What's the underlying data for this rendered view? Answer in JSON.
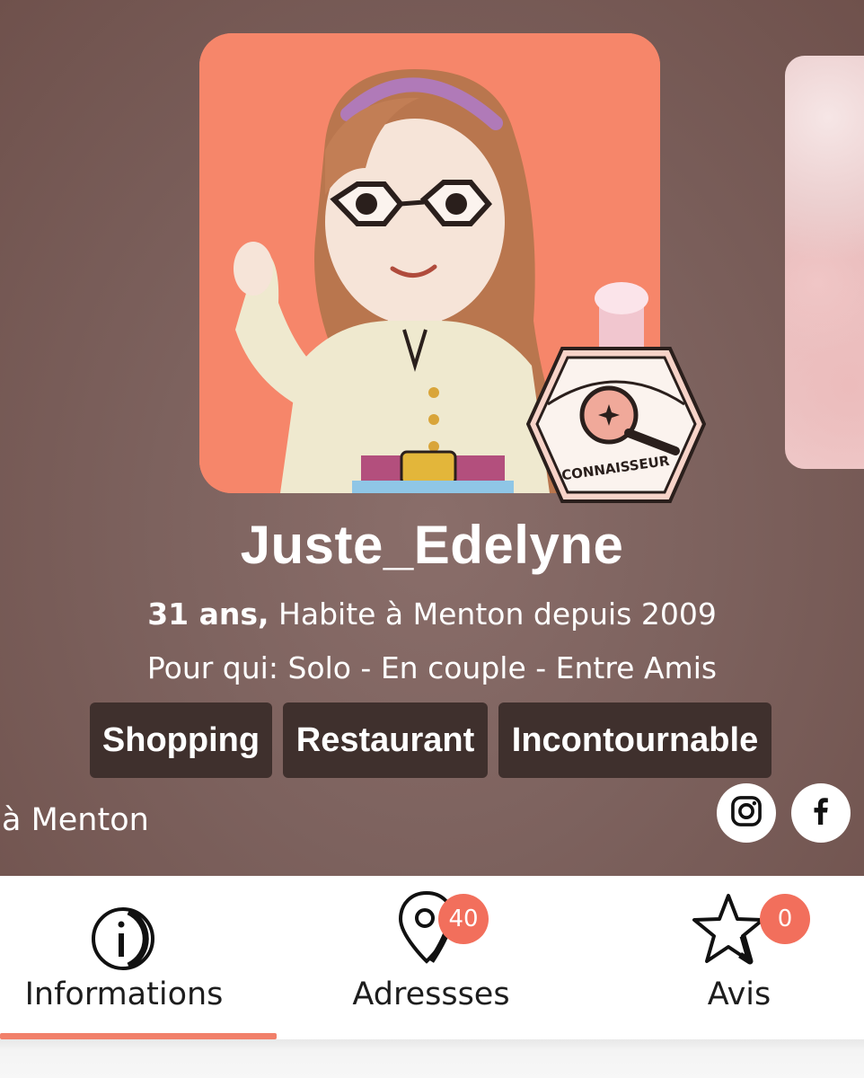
{
  "profile": {
    "username": "Juste_Edelyne",
    "age": "31 ans,",
    "lives": "Habite à Menton depuis 2009",
    "for_whom": "Pour qui: Solo - En couple - Entre Amis",
    "badge_label": "CONNAISSEUR",
    "location": "à Menton"
  },
  "tags": [
    "Shopping",
    "Restaurant",
    "Incontournable"
  ],
  "social": {
    "instagram_icon": "instagram-icon",
    "facebook_icon": "facebook-icon"
  },
  "tabs": [
    {
      "label": "Informations",
      "icon": "info-icon",
      "active": true
    },
    {
      "label": "Adressses",
      "icon": "map-pin-icon",
      "count": "40"
    },
    {
      "label": "Avis",
      "icon": "star-icon",
      "count": "0"
    }
  ],
  "colors": {
    "accent": "#f26f5c",
    "avatar_bg": "#f6866a",
    "tag_bg": "#3f302d",
    "hero_bg": "#7d625e"
  }
}
